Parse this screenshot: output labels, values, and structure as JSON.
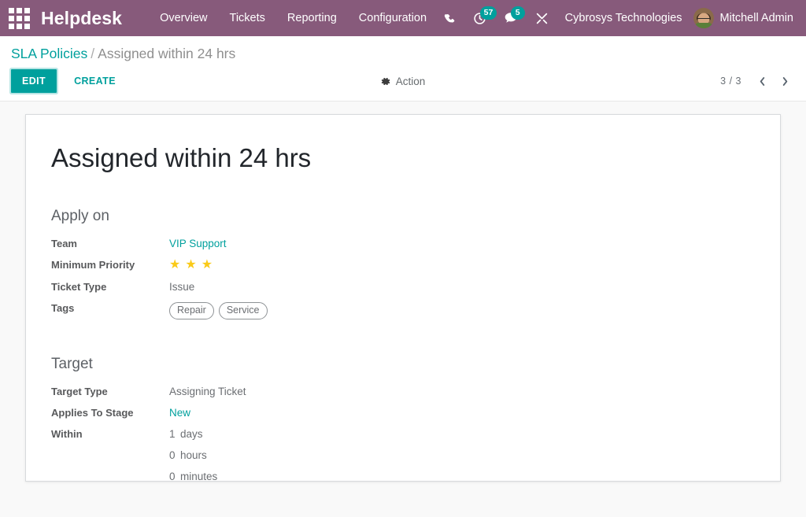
{
  "navbar": {
    "apps_icon": "apps-grid-icon",
    "brand": "Helpdesk",
    "menu": [
      {
        "label": "Overview"
      },
      {
        "label": "Tickets"
      },
      {
        "label": "Reporting"
      },
      {
        "label": "Configuration"
      }
    ],
    "icons": [
      {
        "name": "phone-icon",
        "badge": null
      },
      {
        "name": "activity-clock-icon",
        "badge": "57"
      },
      {
        "name": "messages-icon",
        "badge": "5"
      },
      {
        "name": "tools-icon",
        "badge": null
      }
    ],
    "company": "Cybrosys Technologies",
    "user": "Mitchell Admin",
    "avatar": "user-avatar",
    "color": "#875A7B",
    "badge_color": "#00A09D"
  },
  "control_panel": {
    "breadcrumb": {
      "parent": "SLA Policies",
      "separator": "/",
      "current": "Assigned within 24 hrs"
    },
    "edit_label": "EDIT",
    "create_label": "CREATE",
    "action_label": "Action",
    "action_icon": "gear-icon",
    "pager": {
      "count": "3 / 3",
      "prev_icon": "chevron-left-icon",
      "next_icon": "chevron-right-icon"
    },
    "accent_color": "#00A09D"
  },
  "form": {
    "title": "Assigned within 24 hrs",
    "groups": [
      {
        "title": "Apply on",
        "rows": [
          {
            "label": "Team",
            "value": "VIP Support",
            "type": "link"
          },
          {
            "label": "Minimum Priority",
            "value": "",
            "type": "stars",
            "stars": 3,
            "star_color": "#FACA18"
          },
          {
            "label": "Ticket Type",
            "value": "Issue",
            "type": "text"
          },
          {
            "label": "Tags",
            "value": "",
            "type": "tags",
            "tags": [
              "Repair",
              "Service"
            ]
          }
        ]
      },
      {
        "title": "Target",
        "rows": [
          {
            "label": "Target Type",
            "value": "Assigning Ticket",
            "type": "text"
          },
          {
            "label": "Applies To Stage",
            "value": "New",
            "type": "link"
          },
          {
            "label": "Within",
            "type": "duration",
            "duration": [
              {
                "number": "1",
                "unit": "days"
              },
              {
                "number": "0",
                "unit": "hours"
              },
              {
                "number": "0",
                "unit": "minutes"
              }
            ]
          }
        ]
      }
    ]
  }
}
